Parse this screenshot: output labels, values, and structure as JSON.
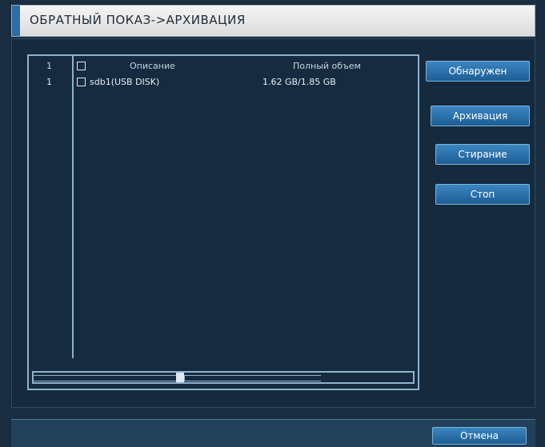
{
  "title": "ОБРАТНЫЙ ПОКАЗ->АРХИВАЦИЯ",
  "list": {
    "header": {
      "index": "1",
      "description": "Описание",
      "capacity": "Полный объем"
    },
    "rows": [
      {
        "index": "1",
        "description": "sdb1(USB DISK)",
        "capacity": "1.62 GB/1.85 GB",
        "checked": false
      }
    ],
    "scroll_position": 0.37
  },
  "buttons": {
    "detect": "Обнаружен",
    "backup": "Архивация",
    "erase": "Стирание",
    "stop": "Стоп",
    "cancel": "Отмена"
  },
  "colors": {
    "background": "#1a2d40",
    "button": "#2a75b0",
    "title_bar": "#e8e8e8",
    "border": "#8fb2cc"
  }
}
